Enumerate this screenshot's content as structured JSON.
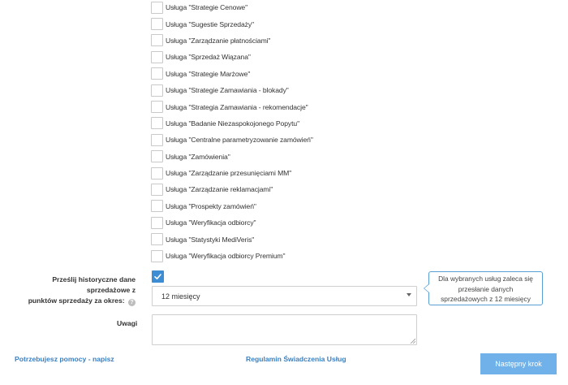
{
  "services": [
    "Usługa \"Strategie Cenowe\"",
    "Usługa \"Sugestie Sprzedaży\"",
    "Usługa \"Zarządzanie płatnościami\"",
    "Usługa \"Sprzedaż Wiązana\"",
    "Usługa \"Strategie Marżowe\"",
    "Usługa \"Strategie Zamawiania - blokady\"",
    "Usługa \"Strategia Zamawiania - rekomendacje\"",
    "Usługa \"Badanie Niezaspokojonego Popytu\"",
    "Usługa \"Centralne parametryzowanie zamówień\"",
    "Usługa \"Zamówienia\"",
    "Usługa \"Zarządzanie przesunięciami MM\"",
    "Usługa \"Zarządzanie reklamacjami\"",
    "Usługa \"Prospekty zamówień\"",
    "Usługa \"Weryfikacja odbiorcy\"",
    "Usługa \"Statystyki MediVeris\"",
    "Usługa \"Weryfikacja odbiorcy Premium\""
  ],
  "history": {
    "label_line1": "Prześlij historyczne dane sprzedażowe z",
    "label_line2": "punktów sprzedaży za okres:",
    "help_icon": "?",
    "checked": true,
    "period_value": "12 miesięcy"
  },
  "tooltip": {
    "line1": "Dla wybranych usług zaleca się",
    "line2": "przesłanie danych",
    "line3": "sprzedażowych z 12 miesięcy"
  },
  "notes": {
    "label": "Uwagi",
    "value": ""
  },
  "footer": {
    "help_link": "Potrzebujesz pomocy - napisz",
    "terms_link": "Regulamin Świadczenia Usług",
    "next_button": "Następny krok"
  },
  "colors": {
    "accent": "#3c8dd4",
    "link": "#3a7fc1",
    "button": "#6fb1e8",
    "tooltip_border": "#5a9fd4"
  }
}
